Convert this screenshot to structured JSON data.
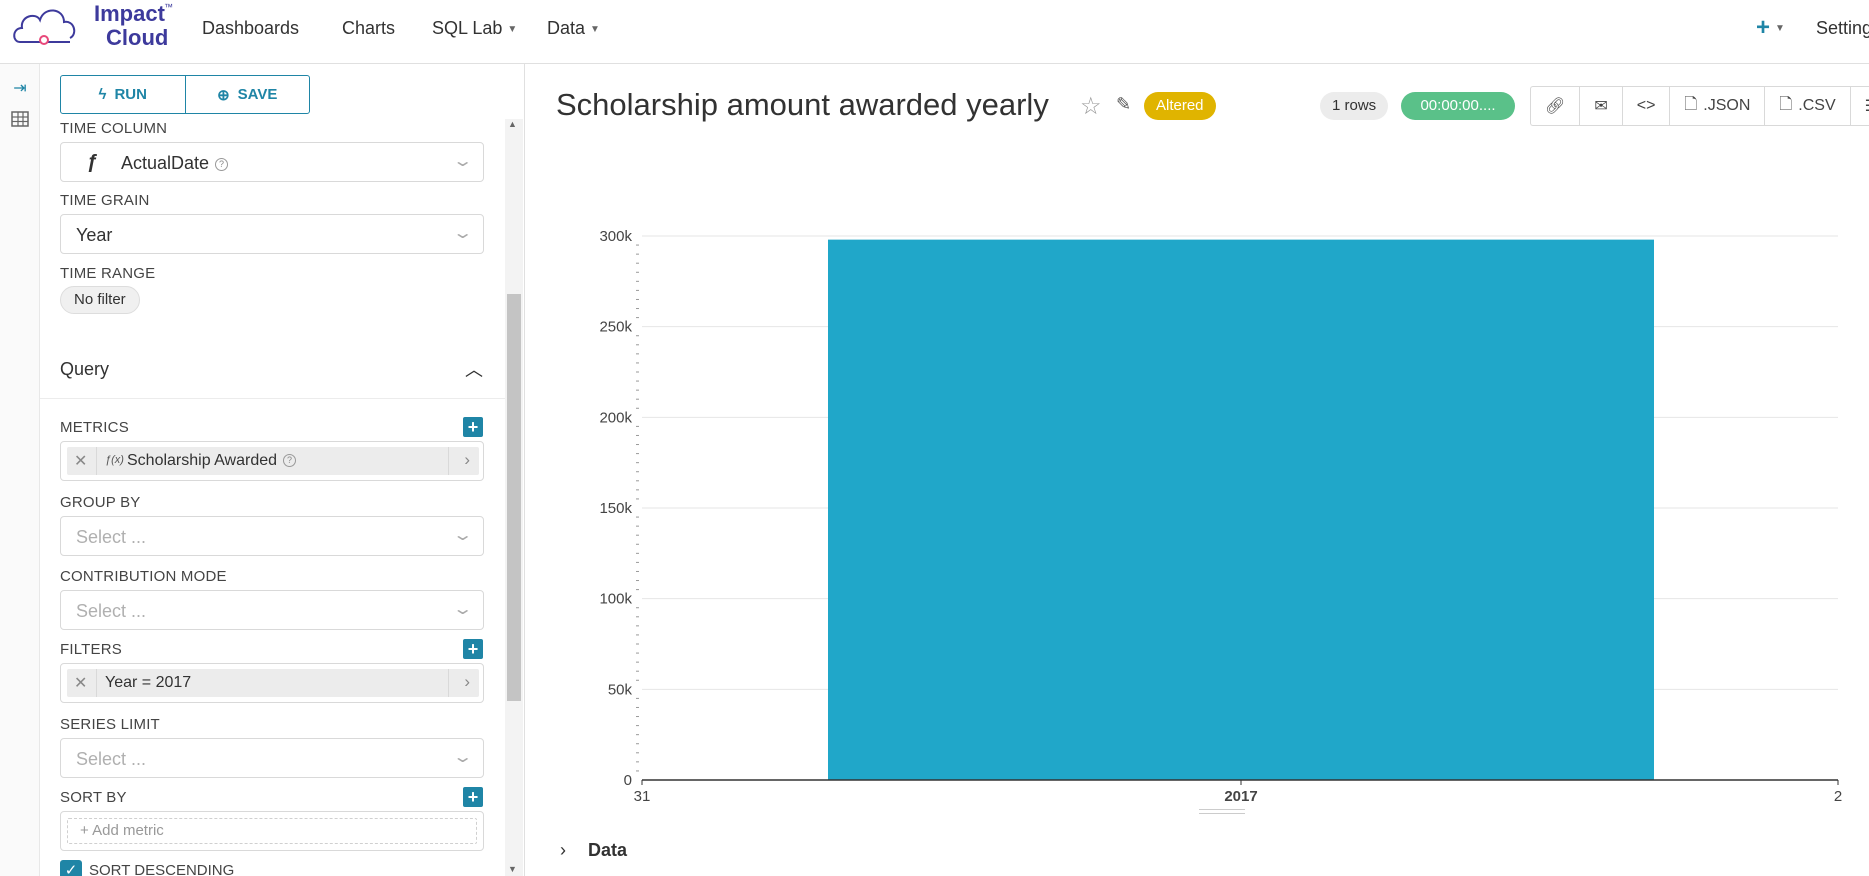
{
  "nav": {
    "logo_line1": "Impact",
    "logo_line2": "Cloud",
    "logo_tm": "™",
    "items": [
      {
        "label": "Dashboards"
      },
      {
        "label": "Charts"
      },
      {
        "label": "SQL Lab"
      },
      {
        "label": "Data"
      }
    ],
    "plus": "+",
    "settings": "Settings"
  },
  "sidebar": {
    "run_label": "RUN",
    "save_label": "SAVE",
    "time_column": {
      "label": "TIME COLUMN",
      "value": "ActualDate",
      "prefix": "ƒ"
    },
    "time_grain": {
      "label": "TIME GRAIN",
      "value": "Year"
    },
    "time_range": {
      "label": "TIME RANGE",
      "value": "No filter"
    },
    "query_title": "Query",
    "metrics": {
      "label": "METRICS",
      "value": "Scholarship Awarded",
      "fx": "ƒ(x)"
    },
    "group_by": {
      "label": "GROUP BY",
      "placeholder": "Select ..."
    },
    "contribution_mode": {
      "label": "CONTRIBUTION MODE",
      "placeholder": "Select ..."
    },
    "filters": {
      "label": "FILTERS",
      "value": "Year = 2017"
    },
    "series_limit": {
      "label": "SERIES LIMIT",
      "placeholder": "Select ..."
    },
    "sort_by": {
      "label": "SORT BY",
      "placeholder": "Add metric"
    },
    "sort_descending": {
      "label": "SORT DESCENDING",
      "checked": true
    }
  },
  "main": {
    "title": "Scholarship amount awarded yearly",
    "altered_badge": "Altered",
    "rows_badge": "1 rows",
    "timer_badge": "00:00:00....",
    "toolbar": {
      "json": ".JSON",
      "csv": ".CSV"
    },
    "data_section": "Data"
  },
  "colors": {
    "accent": "#1f85a6",
    "bar": "#20a7c9",
    "altered": "#e0b400",
    "timer": "#5ac189"
  },
  "chart_data": {
    "type": "bar",
    "categories": [
      "2017"
    ],
    "values": [
      298000
    ],
    "x_tick_labels": [
      "31",
      "2017",
      "2"
    ],
    "y_ticks": [
      "0",
      "50k",
      "100k",
      "150k",
      "200k",
      "250k",
      "300k"
    ],
    "ylim": [
      0,
      300000
    ],
    "grid": true,
    "title": "",
    "xlabel": "",
    "ylabel": ""
  }
}
